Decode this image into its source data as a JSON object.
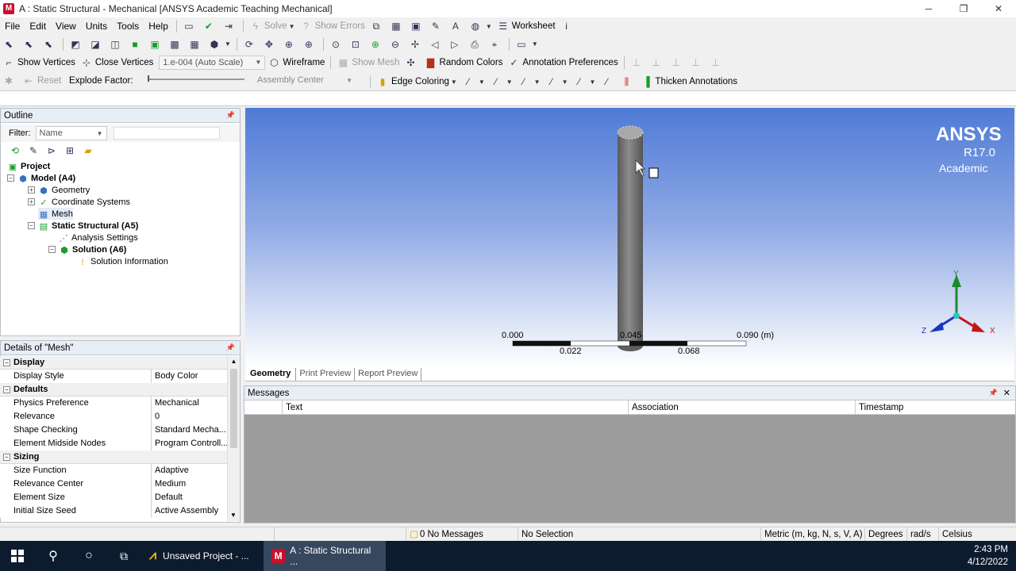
{
  "window": {
    "title": "A : Static Structural - Mechanical [ANSYS Academic Teaching Mechanical]",
    "app_icon_letter": "M",
    "minimize_glyph": "─",
    "maximize_glyph": "❐",
    "close_glyph": "✕"
  },
  "menu": [
    "File",
    "Edit",
    "View",
    "Units",
    "Tools",
    "Help"
  ],
  "toolbar1": {
    "solve": "Solve",
    "show_errors": "Show Errors",
    "worksheet": "Worksheet"
  },
  "toolbar2": {
    "show_vertices": "Show Vertices",
    "close_vertices": "Close Vertices",
    "scale_value": "1.e-004 (Auto Scale)",
    "wireframe": "Wireframe",
    "show_mesh": "Show Mesh",
    "random_colors": "Random Colors",
    "annotation_preferences": "Annotation Preferences"
  },
  "toolbar3": {
    "reset": "Reset",
    "explode_factor": "Explode Factor:",
    "assembly_center": "Assembly Center",
    "edge_coloring": "Edge Coloring",
    "thicken_annotations": "Thicken Annotations"
  },
  "outline": {
    "title": "Outline",
    "filter_label": "Filter:",
    "filter_value": "Name",
    "tree": [
      {
        "label": "Project"
      },
      {
        "label": "Model (A4)"
      },
      {
        "label": "Geometry"
      },
      {
        "label": "Coordinate Systems"
      },
      {
        "label": "Mesh"
      },
      {
        "label": "Static Structural (A5)"
      },
      {
        "label": "Analysis Settings"
      },
      {
        "label": "Solution (A6)"
      },
      {
        "label": "Solution Information"
      }
    ]
  },
  "details": {
    "title": "Details of \"Mesh\"",
    "groups": {
      "display": "Display",
      "defaults": "Defaults",
      "sizing": "Sizing"
    },
    "rows": [
      {
        "k": "Display Style",
        "v": "Body Color"
      },
      {
        "k": "Physics Preference",
        "v": "Mechanical"
      },
      {
        "k": "Relevance",
        "v": "0"
      },
      {
        "k": "Shape Checking",
        "v": "Standard Mecha..."
      },
      {
        "k": "Element Midside Nodes",
        "v": "Program Controll..."
      },
      {
        "k": "Size Function",
        "v": "Adaptive"
      },
      {
        "k": "Relevance Center",
        "v": "Medium"
      },
      {
        "k": "Element Size",
        "v": "Default"
      },
      {
        "k": "Initial Size Seed",
        "v": "Active Assembly"
      }
    ]
  },
  "viewport": {
    "brand": "ANSYS",
    "version": "R17.0",
    "edition": "Academic",
    "scale_labels_top": [
      "0.000",
      "0.045",
      "0.090 (m)"
    ],
    "scale_labels_bottom": [
      "0.022",
      "0.068"
    ],
    "axis_x": "X",
    "axis_y": "Y",
    "axis_z": "Z",
    "tabs": [
      "Geometry",
      "Print Preview",
      "Report Preview"
    ]
  },
  "messages": {
    "title": "Messages",
    "columns": [
      "Text",
      "Association",
      "Timestamp"
    ]
  },
  "status": {
    "message_count": "0",
    "no_messages": "No Messages",
    "no_selection": "No Selection",
    "units": "Metric (m, kg, N, s, V, A)",
    "degrees": "Degrees",
    "rads": "rad/s",
    "celsius": "Celsius"
  },
  "taskbar": {
    "app1": "Unsaved Project - ...",
    "app2": "A : Static Structural ...",
    "time": "2:43 PM",
    "date": "4/12/2022"
  },
  "colors": {
    "viewport_top": "#4f7bd6",
    "taskbar": "#0d1b2e",
    "accent_red": "#c8102e"
  }
}
